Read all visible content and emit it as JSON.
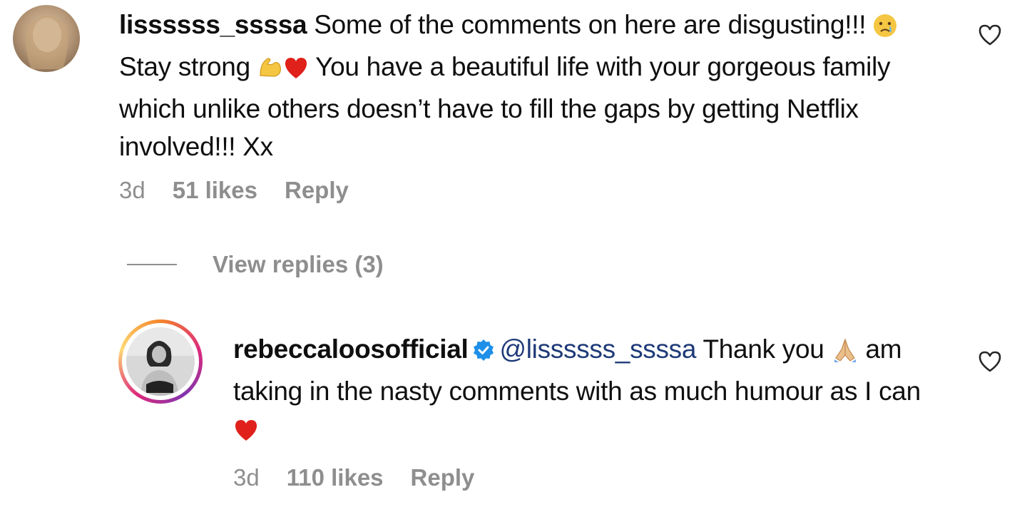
{
  "comment1": {
    "username": "lissssss_ssssa",
    "text_part1": " Some of the comments on here are disgusting!!! ",
    "text_part2": " Stay strong ",
    "text_part3": " You have a beautiful life with your gorgeous family which unlike others doesn’t have to fill the gaps by getting Netflix involved!!! Xx",
    "time": "3d",
    "likes": "51 likes",
    "reply_label": "Reply"
  },
  "view_replies": {
    "label": "View replies (3)"
  },
  "comment2": {
    "username": "rebeccaloosofficial",
    "mention": "@lissssss_ssssa",
    "text_part1": " Thank you ",
    "text_part2": " am taking in the nasty comments with as much humour as I can ",
    "time": "3d",
    "likes": "110 likes",
    "reply_label": "Reply"
  },
  "colors": {
    "meta_gray": "#8e8e8e",
    "mention_blue": "#1e3a78",
    "heart_red": "#e0201b",
    "verified_blue": "#1d8fe8"
  },
  "icons": [
    "like-heart-icon",
    "crying-emoji-icon",
    "flexed-biceps-icon",
    "red-heart-emoji-icon",
    "verified-badge-icon",
    "folded-hands-icon"
  ]
}
